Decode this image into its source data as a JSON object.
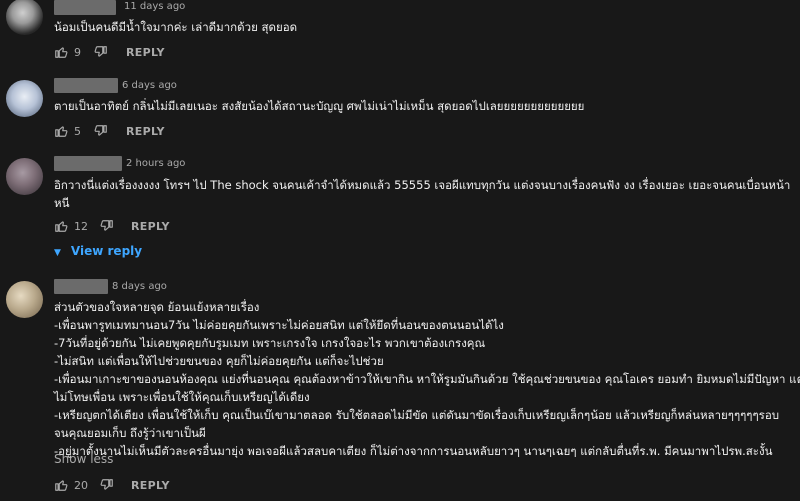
{
  "comments": [
    {
      "timestamp": "11 days ago",
      "lines": [
        "น้อมเป็นคนดีมีน้ำใจมากค่ะ เล่าดีมากด้วย สุดยอด"
      ],
      "likes": "9",
      "reply_label": "REPLY"
    },
    {
      "timestamp": "6 days ago",
      "lines": [
        "ตายเป็นอาทิตย์ กลิ่นไม่มีเลยเนอะ สงสัยน้องได้สถานะบัญญู ศพไม่เน่าไม่เหม็น สุดยอดไปเลยยยยยยยยยยยยย"
      ],
      "likes": "5",
      "reply_label": "REPLY"
    },
    {
      "timestamp": "2 hours ago",
      "lines": [
        "อิกวางนี่แต่งเรื่องงงงง โทรฯ ไป The shock จนคนเค้าจำได้หมดแล้ว 55555 เจอผีแทบทุกวัน แต่งจนบางเรื่องคนฟัง งง เรื่องเยอะ เยอะจนคนเบื่อนหน้า",
        "หนี"
      ],
      "likes": "12",
      "reply_label": "REPLY",
      "view_reply": "View reply"
    },
    {
      "timestamp": "8 days ago",
      "lines": [
        "ส่วนตัวของใจหลายจุด ย้อนแย้งหลายเรื่อง",
        "-เพื่อนพารูทเมทมานอน7วัน ไม่ค่อยคุยกันเพราะไม่ค่อยสนิท แต่ให้ยึดที่นอนของตนนอนได้ไง",
        "-7วันที่อยู่ด้วยกัน ไม่เคยพูดคุยกับรูมเมท เพราะเกรงใจ เกรงใจอะไร พวกเขาต้องเกรงคุณ",
        "-ไม่สนิท แต่เพื่อนให้ไปช่วยขนของ คุยก็ไม่ค่อยคุยกัน แต่ก็จะไปช่วย",
        "-เพื่อนมาเกาะขาของนอนห้องคุณ แย่งที่นอนคุณ คุณต้องหาข้าวให้เขากิน หาให้รูมมันกินด้วย ใช้คุณช่วยขนของ คุณโอเคร ยอมทำ ยิมหมดไม่มีปัญหา แต่",
        "ไม่โทษเพื่อน เพราะเพื่อนใช้ให้คุณเก็บเหรียญได้เดียง",
        "-เหรียญตกได้เตียง เพื่อนใช้ให้เก็บ คุณเป็นเบ๊เขามาตลอด รับใช้ตลอดไม่มีขัด แต่ดันมาขัดเรื่องเก็บเหรียญเล็กๆน้อย แล้วเหรียญก็หล่นหลายๆๆๆๆๆรอบ",
        "จนคุณยอมเก็บ ถึงรู้ว่าเขาเป็นผี",
        "-อยู่มาตั้งนานไม่เห็นมีตัวละครอื่นมายุ่ง พอเจอผีแล้วสลบคาเตียง ก็ไม่ต่างจากการนอนหลับยาวๆ นานๆเฉยๆ แต่กลับตื่นที่ร.พ. มีคนมาพาไปรพ.สะงั้น"
      ],
      "show_less": "Show less",
      "likes": "20",
      "reply_label": "REPLY"
    }
  ]
}
